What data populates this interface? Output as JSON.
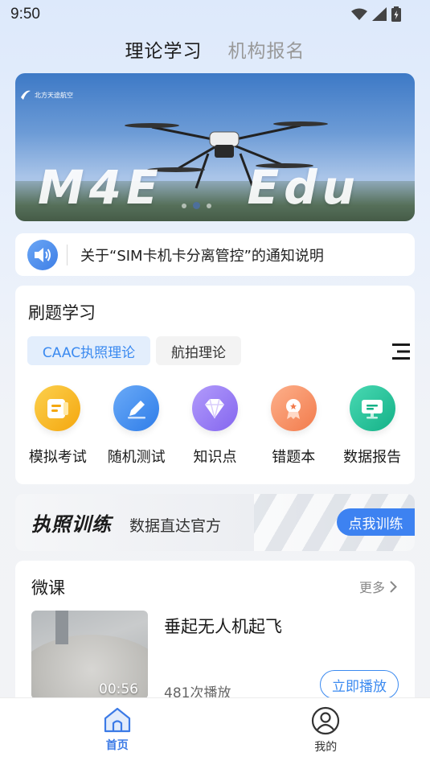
{
  "status_bar": {
    "time": "9:50",
    "icons": [
      "wifi-icon",
      "signal-icon",
      "battery-icon"
    ]
  },
  "top_tabs": [
    {
      "label": "理论学习",
      "active": true
    },
    {
      "label": "机构报名",
      "active": false
    }
  ],
  "banner": {
    "brand": "北方天途航空",
    "model_text": "M4E    Edu",
    "slide_count": 3,
    "active_slide": 2
  },
  "notice": {
    "icon": "speaker-icon",
    "text": "关于“SIM卡机卡分离管控”的通知说明"
  },
  "practice": {
    "title": "刷题学习",
    "chips": [
      {
        "label": "CAAC执照理论",
        "active": true
      },
      {
        "label": "航拍理论",
        "active": false
      }
    ],
    "menu_icon": "list-menu-icon",
    "features": [
      {
        "label": "模拟考试",
        "icon": "exam-paper-icon",
        "color": "#f7b61b"
      },
      {
        "label": "随机测试",
        "icon": "pencil-icon",
        "color": "#3e8ef2"
      },
      {
        "label": "知识点",
        "icon": "diamond-icon",
        "color": "#9c7cf5"
      },
      {
        "label": "错题本",
        "icon": "badge-icon",
        "color": "#f79366"
      },
      {
        "label": "数据报告",
        "icon": "monitor-icon",
        "color": "#1fc29a"
      }
    ]
  },
  "license_banner": {
    "title": "执照训练",
    "subtitle": "数据直达官方",
    "button_label": "点我训练"
  },
  "micro_course": {
    "title": "微课",
    "more_label": "更多",
    "items": [
      {
        "name": "垂起无人机起飞",
        "plays": "481次播放",
        "duration": "00:56",
        "play_label": "立即播放"
      }
    ]
  },
  "bottom_nav": [
    {
      "label": "首页",
      "icon": "home-icon",
      "active": true
    },
    {
      "label": "我的",
      "icon": "user-profile-icon",
      "active": false
    }
  ],
  "colors": {
    "accent": "#3b82f0",
    "notice_icon": "#4a8bf0",
    "active_chip_bg": "#e3eefc"
  }
}
